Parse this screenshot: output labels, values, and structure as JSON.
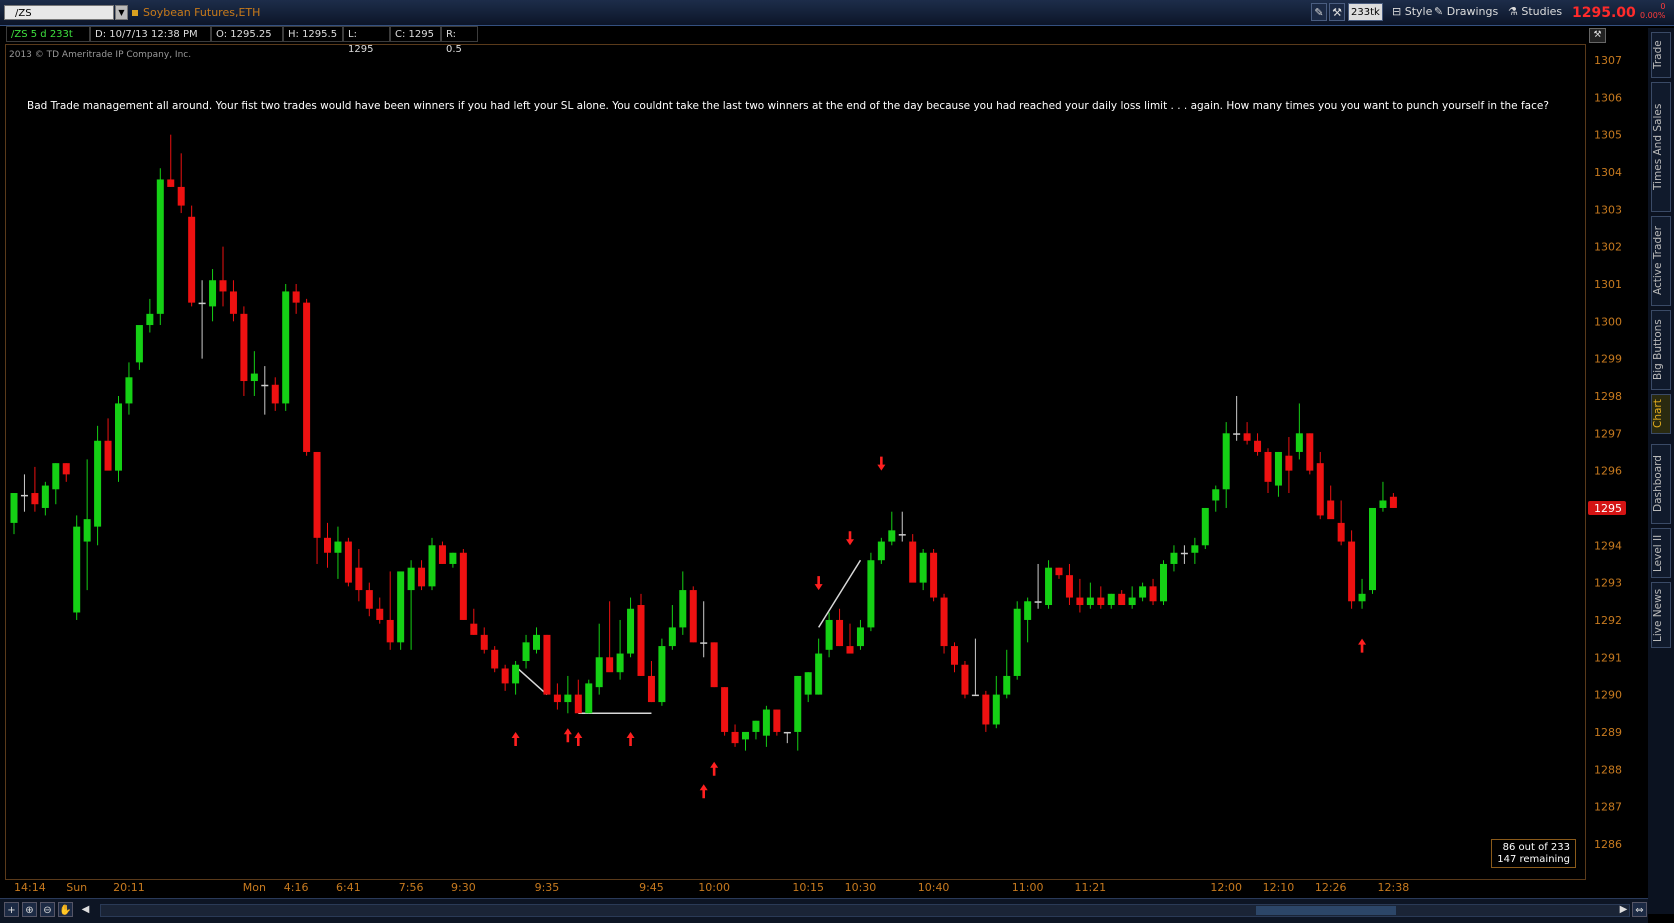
{
  "toolbar": {
    "symbol": "/ZS",
    "description": "Soybean Futures,ETH",
    "tick_badge": "233tk",
    "style_label": "Style",
    "drawings_label": "Drawings",
    "studies_label": "Studies",
    "last_price": "1295.00",
    "change_abs": "0",
    "change_pct": "0.00%"
  },
  "infobar": {
    "symbol_period": "/ZS 5 d 233t",
    "date": "D: 10/7/13 12:38 PM",
    "open": "O: 1295.25",
    "high": "H: 1295.5",
    "low": "L: 1295",
    "close": "C: 1295",
    "range": "R: 0.5"
  },
  "copyright": "2013 © TD Ameritrade IP Company, Inc.",
  "note": "Bad Trade management all around.  Your fist two trades would have been winners if you had left your SL alone.  You couldnt take the last two winners at the end of the day because you had reached your daily loss limit . . . again.  How many times you you want to punch yourself in the face?",
  "counter": {
    "line1": "86  out of 233",
    "line2": "147 remaining"
  },
  "side_tabs": [
    "Trade",
    "Times And Sales",
    "Active Trader",
    "Big Buttons",
    "Chart",
    "Dashboard",
    "Level II",
    "Live News"
  ],
  "colors": {
    "up": "#15d015",
    "down": "#ee1111",
    "axis_text": "#c77a1f",
    "price_label_bg": "#d41414"
  },
  "chart_data": {
    "type": "candlestick",
    "title": "/ZS 5 d 233t",
    "ylim": [
      1285.5,
      1307.5
    ],
    "y_ticks": [
      1286,
      1287,
      1288,
      1289,
      1290,
      1291,
      1292,
      1293,
      1294,
      1295,
      1296,
      1297,
      1298,
      1299,
      1300,
      1301,
      1302,
      1303,
      1304,
      1305,
      1306,
      1307
    ],
    "x_tick_labels": [
      "14:14",
      "Sun",
      "20:11",
      "Mon",
      "4:16",
      "6:41",
      "7:56",
      "9:30",
      "9:35",
      "9:45",
      "10:00",
      "10:15",
      "10:30",
      "10:40",
      "11:00",
      "11:21",
      "12:00",
      "12:10",
      "12:26",
      "12:38"
    ],
    "x_tick_bars": [
      0,
      6,
      11,
      23,
      27,
      32,
      38,
      43,
      51,
      61,
      67,
      76,
      81,
      88,
      97,
      103,
      116,
      121,
      126,
      132
    ],
    "last_price_label": "1295",
    "candles": [
      {
        "o": 1294.6,
        "h": 1295.4,
        "l": 1294.3,
        "c": 1295.4
      },
      {
        "o": 1295.35,
        "h": 1295.9,
        "l": 1294.9,
        "c": 1295.35
      },
      {
        "o": 1295.4,
        "h": 1296.1,
        "l": 1294.9,
        "c": 1295.1
      },
      {
        "o": 1295.0,
        "h": 1295.7,
        "l": 1294.8,
        "c": 1295.6
      },
      {
        "o": 1295.5,
        "h": 1296.2,
        "l": 1295.1,
        "c": 1296.2
      },
      {
        "o": 1296.2,
        "h": 1296.2,
        "l": 1295.7,
        "c": 1295.9
      },
      {
        "o": 1292.2,
        "h": 1294.8,
        "l": 1292.0,
        "c": 1294.5
      },
      {
        "o": 1294.1,
        "h": 1296.3,
        "l": 1292.8,
        "c": 1294.7
      },
      {
        "o": 1294.5,
        "h": 1297.2,
        "l": 1294.0,
        "c": 1296.8
      },
      {
        "o": 1296.8,
        "h": 1297.4,
        "l": 1296.2,
        "c": 1296.0
      },
      {
        "o": 1296.0,
        "h": 1298.0,
        "l": 1295.7,
        "c": 1297.8
      },
      {
        "o": 1297.8,
        "h": 1298.9,
        "l": 1297.5,
        "c": 1298.5
      },
      {
        "o": 1298.9,
        "h": 1299.7,
        "l": 1298.7,
        "c": 1299.9
      },
      {
        "o": 1299.9,
        "h": 1300.6,
        "l": 1299.7,
        "c": 1300.2
      },
      {
        "o": 1300.2,
        "h": 1304.1,
        "l": 1299.9,
        "c": 1303.8
      },
      {
        "o": 1303.8,
        "h": 1305.0,
        "l": 1303.6,
        "c": 1303.6
      },
      {
        "o": 1303.6,
        "h": 1304.5,
        "l": 1302.9,
        "c": 1303.1
      },
      {
        "o": 1302.8,
        "h": 1303.1,
        "l": 1300.4,
        "c": 1300.5
      },
      {
        "o": 1300.5,
        "h": 1301.1,
        "l": 1299.0,
        "c": 1300.5
      },
      {
        "o": 1300.4,
        "h": 1301.4,
        "l": 1300.0,
        "c": 1301.1
      },
      {
        "o": 1301.1,
        "h": 1302.0,
        "l": 1300.4,
        "c": 1300.8
      },
      {
        "o": 1300.8,
        "h": 1301.1,
        "l": 1300.0,
        "c": 1300.2
      },
      {
        "o": 1300.2,
        "h": 1300.4,
        "l": 1298.0,
        "c": 1298.4
      },
      {
        "o": 1298.4,
        "h": 1299.2,
        "l": 1298.0,
        "c": 1298.6
      },
      {
        "o": 1298.3,
        "h": 1298.8,
        "l": 1297.5,
        "c": 1298.3
      },
      {
        "o": 1298.3,
        "h": 1298.5,
        "l": 1297.6,
        "c": 1297.8
      },
      {
        "o": 1297.8,
        "h": 1301.0,
        "l": 1297.6,
        "c": 1300.8
      },
      {
        "o": 1300.8,
        "h": 1301.0,
        "l": 1300.2,
        "c": 1300.5
      },
      {
        "o": 1300.5,
        "h": 1300.6,
        "l": 1296.4,
        "c": 1296.5
      },
      {
        "o": 1296.5,
        "h": 1296.5,
        "l": 1293.5,
        "c": 1294.2
      },
      {
        "o": 1294.2,
        "h": 1294.6,
        "l": 1293.4,
        "c": 1293.8
      },
      {
        "o": 1293.8,
        "h": 1294.5,
        "l": 1293.1,
        "c": 1294.1
      },
      {
        "o": 1294.1,
        "h": 1294.2,
        "l": 1292.9,
        "c": 1293.0
      },
      {
        "o": 1293.4,
        "h": 1293.9,
        "l": 1292.5,
        "c": 1292.8
      },
      {
        "o": 1292.8,
        "h": 1293.0,
        "l": 1292.1,
        "c": 1292.3
      },
      {
        "o": 1292.3,
        "h": 1292.6,
        "l": 1291.9,
        "c": 1292.0
      },
      {
        "o": 1292.0,
        "h": 1293.3,
        "l": 1291.2,
        "c": 1291.4
      },
      {
        "o": 1291.4,
        "h": 1293.2,
        "l": 1291.2,
        "c": 1293.3
      },
      {
        "o": 1292.8,
        "h": 1293.6,
        "l": 1291.2,
        "c": 1293.4
      },
      {
        "o": 1293.4,
        "h": 1293.6,
        "l": 1292.8,
        "c": 1292.9
      },
      {
        "o": 1292.9,
        "h": 1294.2,
        "l": 1292.8,
        "c": 1294.0
      },
      {
        "o": 1294.0,
        "h": 1294.1,
        "l": 1293.5,
        "c": 1293.5
      },
      {
        "o": 1293.5,
        "h": 1293.8,
        "l": 1293.4,
        "c": 1293.8
      },
      {
        "o": 1293.8,
        "h": 1293.9,
        "l": 1292.0,
        "c": 1292.0
      },
      {
        "o": 1291.9,
        "h": 1292.3,
        "l": 1291.6,
        "c": 1291.6
      },
      {
        "o": 1291.6,
        "h": 1291.8,
        "l": 1291.1,
        "c": 1291.2
      },
      {
        "o": 1291.2,
        "h": 1291.3,
        "l": 1290.6,
        "c": 1290.7
      },
      {
        "o": 1290.7,
        "h": 1290.8,
        "l": 1290.1,
        "c": 1290.3
      },
      {
        "o": 1290.3,
        "h": 1290.9,
        "l": 1290.0,
        "c": 1290.8
      },
      {
        "o": 1290.9,
        "h": 1291.6,
        "l": 1290.7,
        "c": 1291.4
      },
      {
        "o": 1291.2,
        "h": 1291.8,
        "l": 1291.1,
        "c": 1291.6
      },
      {
        "o": 1291.6,
        "h": 1291.6,
        "l": 1290.0,
        "c": 1290.0
      },
      {
        "o": 1290.0,
        "h": 1290.3,
        "l": 1289.6,
        "c": 1289.8
      },
      {
        "o": 1289.8,
        "h": 1290.5,
        "l": 1289.5,
        "c": 1290.0
      },
      {
        "o": 1290.0,
        "h": 1290.4,
        "l": 1289.6,
        "c": 1289.5
      },
      {
        "o": 1289.5,
        "h": 1290.4,
        "l": 1289.5,
        "c": 1290.3
      },
      {
        "o": 1290.2,
        "h": 1291.9,
        "l": 1290.0,
        "c": 1291.0
      },
      {
        "o": 1291.0,
        "h": 1292.5,
        "l": 1290.9,
        "c": 1290.6
      },
      {
        "o": 1290.6,
        "h": 1292.0,
        "l": 1290.4,
        "c": 1291.1
      },
      {
        "o": 1291.1,
        "h": 1292.6,
        "l": 1291.0,
        "c": 1292.3
      },
      {
        "o": 1292.4,
        "h": 1292.7,
        "l": 1290.5,
        "c": 1290.5
      },
      {
        "o": 1290.5,
        "h": 1290.9,
        "l": 1289.8,
        "c": 1289.8
      },
      {
        "o": 1289.8,
        "h": 1291.5,
        "l": 1289.7,
        "c": 1291.3
      },
      {
        "o": 1291.3,
        "h": 1292.4,
        "l": 1291.2,
        "c": 1291.8
      },
      {
        "o": 1291.8,
        "h": 1293.3,
        "l": 1291.6,
        "c": 1292.8
      },
      {
        "o": 1292.8,
        "h": 1292.9,
        "l": 1291.4,
        "c": 1291.4
      },
      {
        "o": 1291.4,
        "h": 1292.5,
        "l": 1291.0,
        "c": 1291.4
      },
      {
        "o": 1291.4,
        "h": 1291.4,
        "l": 1290.2,
        "c": 1290.2
      },
      {
        "o": 1290.2,
        "h": 1290.2,
        "l": 1288.9,
        "c": 1289.0
      },
      {
        "o": 1289.0,
        "h": 1289.2,
        "l": 1288.6,
        "c": 1288.7
      },
      {
        "o": 1288.8,
        "h": 1289.0,
        "l": 1288.5,
        "c": 1289.0
      },
      {
        "o": 1289.0,
        "h": 1289.3,
        "l": 1288.8,
        "c": 1289.3
      },
      {
        "o": 1288.9,
        "h": 1289.7,
        "l": 1288.6,
        "c": 1289.6
      },
      {
        "o": 1289.6,
        "h": 1289.6,
        "l": 1288.9,
        "c": 1289.0
      },
      {
        "o": 1289.0,
        "h": 1289.0,
        "l": 1288.7,
        "c": 1289.0
      },
      {
        "o": 1289.0,
        "h": 1290.5,
        "l": 1288.5,
        "c": 1290.5
      },
      {
        "o": 1290.0,
        "h": 1290.6,
        "l": 1289.8,
        "c": 1290.6
      },
      {
        "o": 1290.0,
        "h": 1291.5,
        "l": 1290.0,
        "c": 1291.1
      },
      {
        "o": 1291.2,
        "h": 1292.2,
        "l": 1291.0,
        "c": 1292.0
      },
      {
        "o": 1292.0,
        "h": 1292.3,
        "l": 1291.3,
        "c": 1291.3
      },
      {
        "o": 1291.3,
        "h": 1291.9,
        "l": 1291.1,
        "c": 1291.1
      },
      {
        "o": 1291.3,
        "h": 1292.0,
        "l": 1291.2,
        "c": 1291.8
      },
      {
        "o": 1291.8,
        "h": 1293.8,
        "l": 1291.7,
        "c": 1293.6
      },
      {
        "o": 1293.6,
        "h": 1294.2,
        "l": 1293.5,
        "c": 1294.1
      },
      {
        "o": 1294.1,
        "h": 1294.9,
        "l": 1294.0,
        "c": 1294.4
      },
      {
        "o": 1294.3,
        "h": 1294.9,
        "l": 1294.1,
        "c": 1294.3
      },
      {
        "o": 1294.1,
        "h": 1294.3,
        "l": 1293.6,
        "c": 1293.0
      },
      {
        "o": 1293.0,
        "h": 1293.9,
        "l": 1292.8,
        "c": 1293.8
      },
      {
        "o": 1293.8,
        "h": 1293.9,
        "l": 1292.5,
        "c": 1292.6
      },
      {
        "o": 1292.6,
        "h": 1292.7,
        "l": 1291.1,
        "c": 1291.3
      },
      {
        "o": 1291.3,
        "h": 1291.4,
        "l": 1290.6,
        "c": 1290.8
      },
      {
        "o": 1290.8,
        "h": 1290.9,
        "l": 1289.9,
        "c": 1290.0
      },
      {
        "o": 1290.0,
        "h": 1291.5,
        "l": 1290.0,
        "c": 1290.0
      },
      {
        "o": 1290.0,
        "h": 1290.1,
        "l": 1289.0,
        "c": 1289.2
      },
      {
        "o": 1289.2,
        "h": 1290.5,
        "l": 1289.1,
        "c": 1290.0
      },
      {
        "o": 1290.0,
        "h": 1291.2,
        "l": 1289.9,
        "c": 1290.5
      },
      {
        "o": 1290.5,
        "h": 1292.5,
        "l": 1290.4,
        "c": 1292.3
      },
      {
        "o": 1292.0,
        "h": 1292.6,
        "l": 1291.4,
        "c": 1292.5
      },
      {
        "o": 1292.5,
        "h": 1293.5,
        "l": 1292.3,
        "c": 1292.5
      },
      {
        "o": 1292.4,
        "h": 1293.6,
        "l": 1292.3,
        "c": 1293.4
      },
      {
        "o": 1293.4,
        "h": 1293.4,
        "l": 1293.1,
        "c": 1293.2
      },
      {
        "o": 1293.2,
        "h": 1293.5,
        "l": 1292.4,
        "c": 1292.6
      },
      {
        "o": 1292.6,
        "h": 1293.1,
        "l": 1292.2,
        "c": 1292.4
      },
      {
        "o": 1292.4,
        "h": 1293.0,
        "l": 1292.3,
        "c": 1292.6
      },
      {
        "o": 1292.6,
        "h": 1292.9,
        "l": 1292.3,
        "c": 1292.4
      },
      {
        "o": 1292.4,
        "h": 1292.7,
        "l": 1292.3,
        "c": 1292.7
      },
      {
        "o": 1292.7,
        "h": 1292.8,
        "l": 1292.4,
        "c": 1292.4
      },
      {
        "o": 1292.4,
        "h": 1292.9,
        "l": 1292.3,
        "c": 1292.6
      },
      {
        "o": 1292.6,
        "h": 1293.0,
        "l": 1292.5,
        "c": 1292.9
      },
      {
        "o": 1292.9,
        "h": 1293.1,
        "l": 1292.4,
        "c": 1292.5
      },
      {
        "o": 1292.5,
        "h": 1293.6,
        "l": 1292.4,
        "c": 1293.5
      },
      {
        "o": 1293.5,
        "h": 1294.0,
        "l": 1293.3,
        "c": 1293.8
      },
      {
        "o": 1293.8,
        "h": 1294.0,
        "l": 1293.5,
        "c": 1293.8
      },
      {
        "o": 1293.8,
        "h": 1294.2,
        "l": 1293.5,
        "c": 1294.0
      },
      {
        "o": 1294.0,
        "h": 1295.0,
        "l": 1293.9,
        "c": 1295.0
      },
      {
        "o": 1295.2,
        "h": 1295.6,
        "l": 1294.9,
        "c": 1295.5
      },
      {
        "o": 1295.5,
        "h": 1297.3,
        "l": 1295.0,
        "c": 1297.0
      },
      {
        "o": 1297.0,
        "h": 1298.0,
        "l": 1296.8,
        "c": 1297.0
      },
      {
        "o": 1297.0,
        "h": 1297.3,
        "l": 1296.7,
        "c": 1296.8
      },
      {
        "o": 1296.8,
        "h": 1297.0,
        "l": 1296.4,
        "c": 1296.5
      },
      {
        "o": 1296.5,
        "h": 1296.6,
        "l": 1295.4,
        "c": 1295.7
      },
      {
        "o": 1295.6,
        "h": 1296.5,
        "l": 1295.3,
        "c": 1296.5
      },
      {
        "o": 1296.4,
        "h": 1296.9,
        "l": 1295.4,
        "c": 1296.0
      },
      {
        "o": 1296.5,
        "h": 1297.8,
        "l": 1296.3,
        "c": 1297.0
      },
      {
        "o": 1297.0,
        "h": 1297.0,
        "l": 1295.9,
        "c": 1296.0
      },
      {
        "o": 1296.2,
        "h": 1296.5,
        "l": 1294.7,
        "c": 1294.8
      },
      {
        "o": 1295.2,
        "h": 1295.6,
        "l": 1294.8,
        "c": 1294.7
      },
      {
        "o": 1294.6,
        "h": 1295.2,
        "l": 1294.0,
        "c": 1294.1
      },
      {
        "o": 1294.1,
        "h": 1294.4,
        "l": 1292.3,
        "c": 1292.5
      },
      {
        "o": 1292.5,
        "h": 1293.1,
        "l": 1292.3,
        "c": 1292.7
      },
      {
        "o": 1292.8,
        "h": 1295.0,
        "l": 1292.7,
        "c": 1295.0
      },
      {
        "o": 1295.0,
        "h": 1295.7,
        "l": 1294.9,
        "c": 1295.2
      },
      {
        "o": 1295.3,
        "h": 1295.4,
        "l": 1295.0,
        "c": 1295.0
      }
    ],
    "up_arrows": [
      {
        "bar": 48,
        "price": 1289.0
      },
      {
        "bar": 53,
        "price": 1289.1
      },
      {
        "bar": 54,
        "price": 1289.0
      },
      {
        "bar": 59,
        "price": 1289.0
      },
      {
        "bar": 66,
        "price": 1287.6
      },
      {
        "bar": 67,
        "price": 1288.2
      },
      {
        "bar": 129,
        "price": 1291.5
      }
    ],
    "down_arrows": [
      {
        "bar": 77,
        "price": 1292.8
      },
      {
        "bar": 80,
        "price": 1294.0
      },
      {
        "bar": 83,
        "price": 1296.0
      }
    ],
    "trade_lines": [
      {
        "b1": 48,
        "p1": 1290.75,
        "b2": 51,
        "p2": 1290.0
      },
      {
        "b1": 54,
        "p1": 1289.5,
        "b2": 61,
        "p2": 1289.5
      },
      {
        "b1": 77,
        "p1": 1291.8,
        "b2": 81,
        "p2": 1293.6
      }
    ]
  }
}
